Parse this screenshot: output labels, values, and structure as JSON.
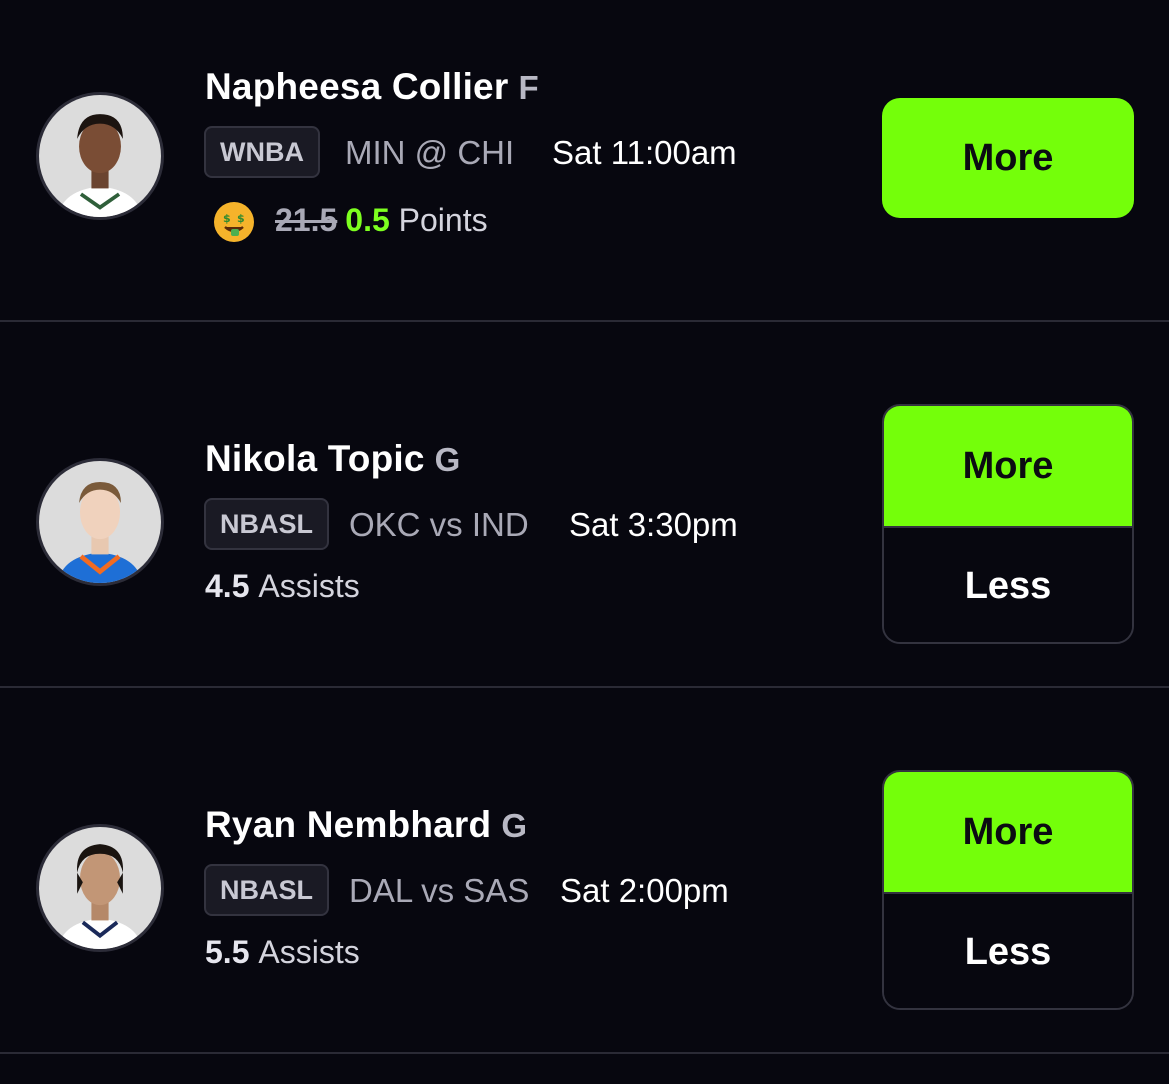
{
  "players": [
    {
      "name": "Napheesa Collier",
      "position": "F",
      "league": "WNBA",
      "matchup": "MIN @ CHI",
      "time": "Sat 11:00am",
      "stat_old": "21.5",
      "stat_new": "0.5",
      "stat_label": "Points",
      "promo_icon": "money-mouth-face-icon",
      "more_label": "More"
    },
    {
      "name": "Nikola Topic",
      "position": "G",
      "league": "NBASL",
      "matchup": "OKC vs IND",
      "time": "Sat 3:30pm",
      "stat_value": "4.5",
      "stat_label": "Assists",
      "more_label": "More",
      "less_label": "Less"
    },
    {
      "name": "Ryan Nembhard",
      "position": "G",
      "league": "NBASL",
      "matchup": "DAL vs SAS",
      "time": "Sat 2:00pm",
      "stat_value": "5.5",
      "stat_label": "Assists",
      "more_label": "More",
      "less_label": "Less"
    }
  ],
  "colors": {
    "background": "#07070f",
    "accent_green": "#74ff0a",
    "promo_value_green": "#7dff1f",
    "divider": "#2a2a35"
  }
}
